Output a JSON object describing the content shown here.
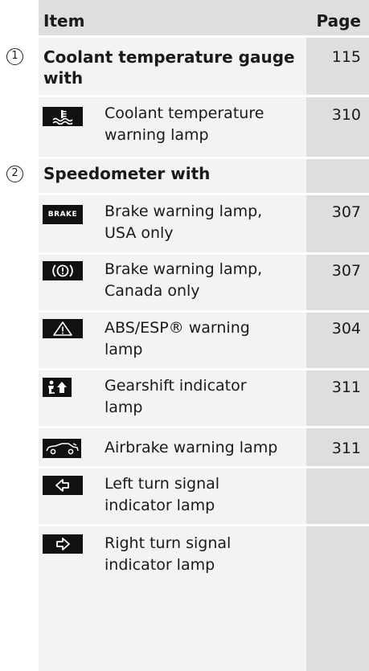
{
  "header": {
    "item": "Item",
    "page": "Page"
  },
  "groups": [
    {
      "number": "1",
      "title_line1": "Coolant temperature gauge",
      "title_line2": "with",
      "page": "115",
      "items": [
        {
          "icon": "coolant-temperature-icon",
          "line1": "Coolant temperature",
          "line2": "warning lamp",
          "page": "310"
        }
      ]
    },
    {
      "number": "2",
      "title_line1": "Speedometer with",
      "title_line2": "",
      "page": "",
      "items": [
        {
          "icon": "brake-text-icon",
          "icon_text": "BRAKE",
          "line1": "Brake warning lamp,",
          "line2": "USA only",
          "page": "307"
        },
        {
          "icon": "brake-circle-icon",
          "line1": "Brake warning lamp,",
          "line2": "Canada only",
          "page": "307"
        },
        {
          "icon": "warning-triangle-icon",
          "line1": "ABS/ESP® warning",
          "line2": "lamp",
          "page": "304"
        },
        {
          "icon": "gearshift-indicator-icon",
          "line1": "Gearshift indicator",
          "line2": "lamp",
          "page": "311"
        },
        {
          "icon": "airbrake-car-icon",
          "line1": "Airbrake warning lamp",
          "line2": "",
          "page": "311"
        },
        {
          "icon": "left-arrow-icon",
          "line1": "Left turn signal",
          "line2": "indicator lamp",
          "page": ""
        },
        {
          "icon": "right-arrow-icon",
          "line1": "Right turn signal",
          "line2": "indicator lamp",
          "page": ""
        }
      ]
    }
  ]
}
